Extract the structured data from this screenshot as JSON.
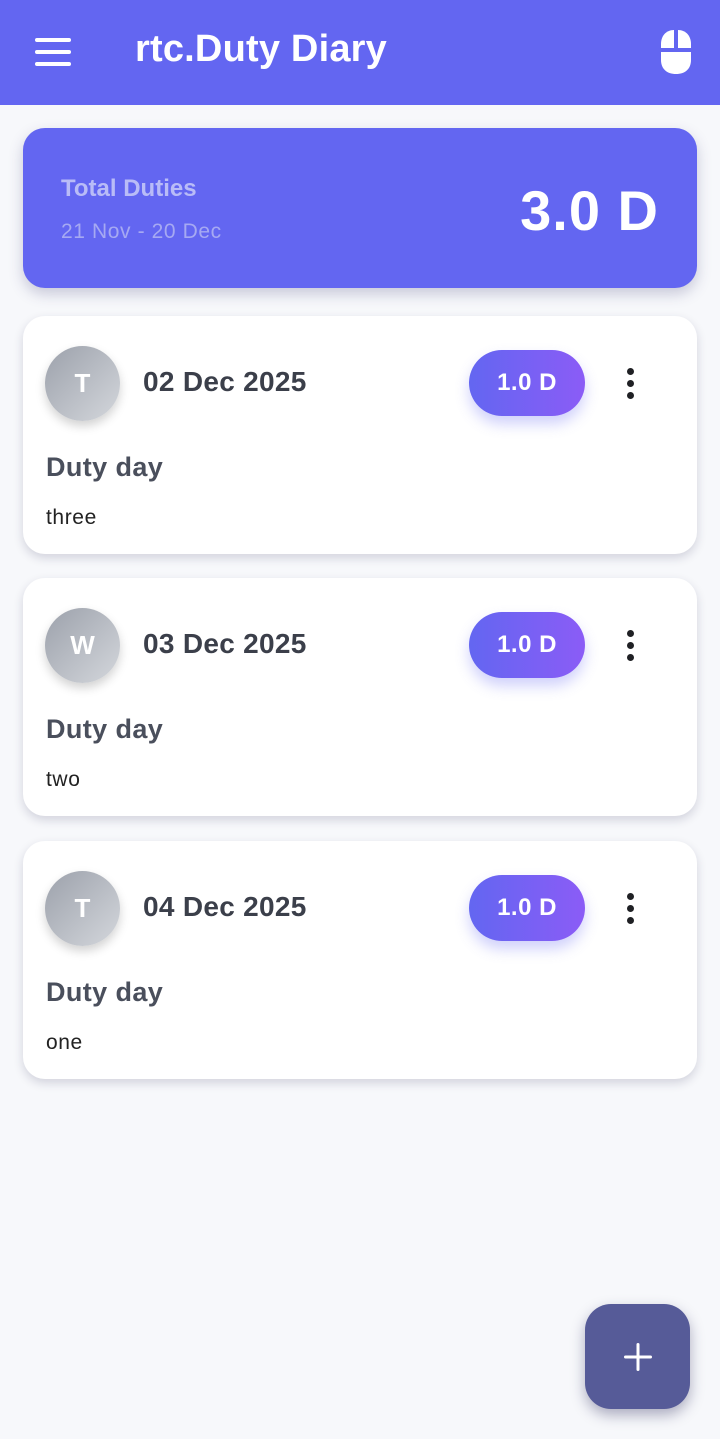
{
  "appbar": {
    "title": "rtc.Duty Diary",
    "menu_icon": "hamburger-menu-icon",
    "action_icon": "mouse-icon",
    "color": "#6366f1"
  },
  "summary": {
    "title": "Total Duties",
    "range": "21 Nov - 20 Dec",
    "total": "3.0 D"
  },
  "duties": [
    {
      "avatar": "T",
      "date": "02 Dec 2025",
      "badge": "1.0 D",
      "type": "Duty day",
      "note": "three"
    },
    {
      "avatar": "W",
      "date": "03 Dec 2025",
      "badge": "1.0 D",
      "type": "Duty day",
      "note": "two"
    },
    {
      "avatar": "T",
      "date": "04 Dec 2025",
      "badge": "1.0 D",
      "type": "Duty day",
      "note": "one"
    }
  ],
  "fab": {
    "icon": "plus-icon",
    "color": "#565b98"
  },
  "colors": {
    "accent": "#6366f1",
    "badge_end": "#8b5cf6",
    "background": "#f7f8fb"
  }
}
